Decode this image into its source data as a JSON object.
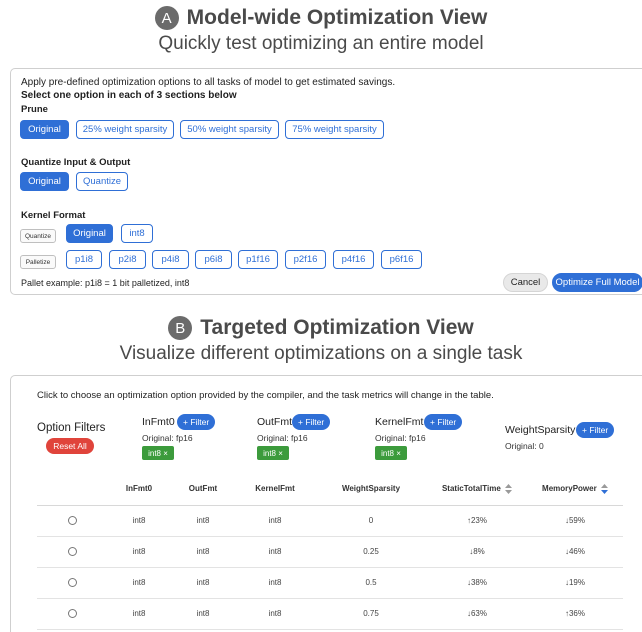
{
  "section_a": {
    "letter": "A",
    "title": "Model-wide Optimization View",
    "subtitle": "Quickly test optimizing an entire model",
    "intro": "Apply pre-defined optimization options to all tasks of model to get estimated savings.",
    "instruction": "Select one option in each of 3 sections below",
    "prune": {
      "label": "Prune",
      "options": [
        "Original",
        "25% weight sparsity",
        "50% weight sparsity",
        "75% weight sparsity"
      ],
      "selected": "Original"
    },
    "quantize_io": {
      "label": "Quantize Input & Output",
      "options": [
        "Original",
        "Quantize"
      ],
      "selected": "Original"
    },
    "kernel_format": {
      "label": "Kernel Format",
      "quantize_tag": "Quantize",
      "quantize_options": [
        "Original",
        "int8"
      ],
      "quantize_selected": "Original",
      "palletize_tag": "Palletize",
      "palletize_options": [
        "p1i8",
        "p2i8",
        "p4i8",
        "p6i8",
        "p1f16",
        "p2f16",
        "p4f16",
        "p6f16"
      ]
    },
    "pallet_example": "Pallet example: p1i8 = 1 bit palletized, int8",
    "cancel_label": "Cancel",
    "optimize_label": "Optimize Full Model"
  },
  "section_b": {
    "letter": "B",
    "title": "Targeted Optimization View",
    "subtitle": "Visualize different optimizations on a single task",
    "intro": "Click to choose an optimization option provided by the compiler, and the task metrics will change in the table.",
    "option_filters_label": "Option Filters",
    "reset_label": "Reset All",
    "filters": [
      {
        "name": "InFmt0",
        "add_label": "+ Filter",
        "original": "Original: fp16",
        "chip": "int8 ×"
      },
      {
        "name": "OutFmt",
        "add_label": "+ Filter",
        "original": "Original: fp16",
        "chip": "int8 ×"
      },
      {
        "name": "KernelFmt",
        "add_label": "+ Filter",
        "original": "Original: fp16",
        "chip": "int8 ×"
      },
      {
        "name": "WeightSparsity",
        "add_label": "+ Filter",
        "original": "Original: 0",
        "chip": ""
      }
    ],
    "table": {
      "columns": [
        "",
        "InFmt0",
        "OutFmt",
        "KernelFmt",
        "WeightSparsity",
        "StaticTotalTime",
        "MemoryPower"
      ],
      "rows": [
        {
          "infmt": "int8",
          "outfmt": "int8",
          "kernelfmt": "int8",
          "sparsity": "0",
          "time": "↑23%",
          "time_dir": "up",
          "power": "↓59%",
          "power_dir": "down"
        },
        {
          "infmt": "int8",
          "outfmt": "int8",
          "kernelfmt": "int8",
          "sparsity": "0.25",
          "time": "↓8%",
          "time_dir": "down",
          "power": "↓46%",
          "power_dir": "down"
        },
        {
          "infmt": "int8",
          "outfmt": "int8",
          "kernelfmt": "int8",
          "sparsity": "0.5",
          "time": "↓38%",
          "time_dir": "down",
          "power": "↓19%",
          "power_dir": "down"
        },
        {
          "infmt": "int8",
          "outfmt": "int8",
          "kernelfmt": "int8",
          "sparsity": "0.75",
          "time": "↓63%",
          "time_dir": "down",
          "power": "↑36%",
          "power_dir": "up"
        }
      ]
    }
  },
  "colors": {
    "accent": "#2f6fd6",
    "danger": "#e0443b",
    "success": "#3c9b3c",
    "increase_text": "#e0443b",
    "decrease_text": "#2f9f3a"
  }
}
